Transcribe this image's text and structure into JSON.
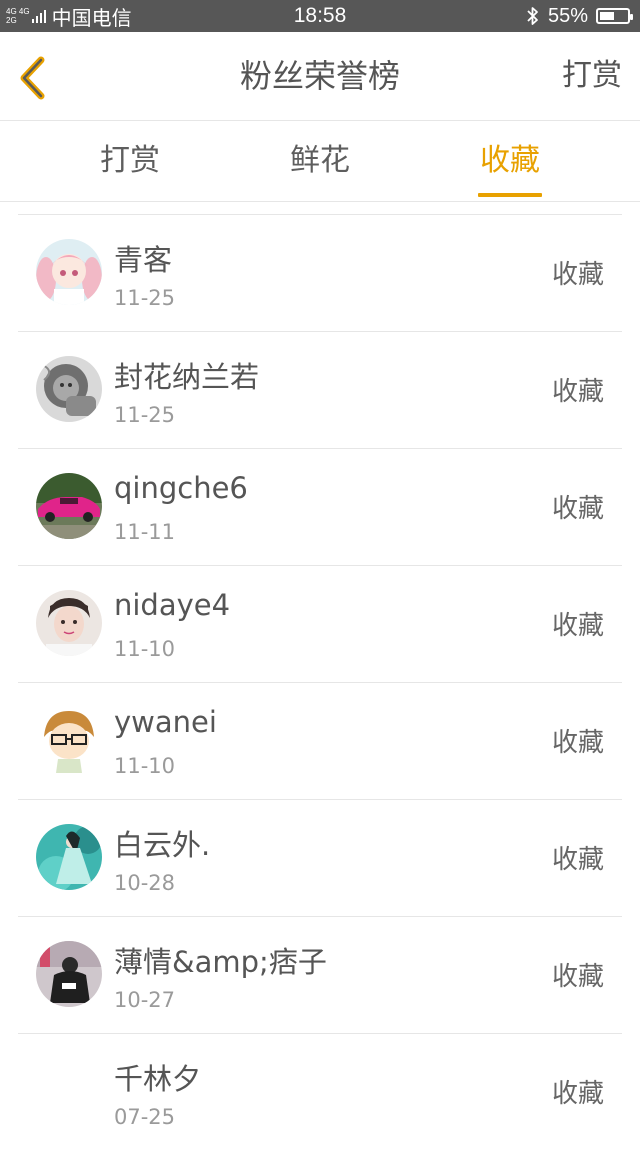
{
  "status_bar": {
    "network_top": "4G 4G",
    "network_bottom": "2G",
    "carrier": "中国电信",
    "time": "18:58",
    "battery_text": "55%",
    "battery_level": 0.55
  },
  "header": {
    "title": "粉丝荣誉榜",
    "action": "打赏",
    "back_icon": "chevron-left-icon",
    "accent_color": "#e8a100"
  },
  "tabs": [
    {
      "label": "打赏",
      "active": false
    },
    {
      "label": "鲜花",
      "active": false
    },
    {
      "label": "收藏",
      "active": true
    }
  ],
  "list": [
    {
      "name": "青客",
      "date": "11-25",
      "type": "收藏",
      "avatar": "anime-girl-avatar"
    },
    {
      "name": "封花纳兰若",
      "date": "11-25",
      "type": "收藏",
      "avatar": "lion-avatar"
    },
    {
      "name": "qingche6",
      "date": "11-11",
      "type": "收藏",
      "avatar": "pink-car-avatar"
    },
    {
      "name": "nidaye4",
      "date": "11-10",
      "type": "收藏",
      "avatar": "boy-photo-avatar"
    },
    {
      "name": "ywanei",
      "date": "11-10",
      "type": "收藏",
      "avatar": "cartoon-glasses-avatar"
    },
    {
      "name": "白云外.",
      "date": "10-28",
      "type": "收藏",
      "avatar": "teal-figure-avatar"
    },
    {
      "name": "薄情&amp;痞子",
      "date": "10-27",
      "type": "收藏",
      "avatar": "hoodie-photo-avatar"
    },
    {
      "name": "千林夕",
      "date": "07-25",
      "type": "收藏",
      "avatar": ""
    }
  ]
}
